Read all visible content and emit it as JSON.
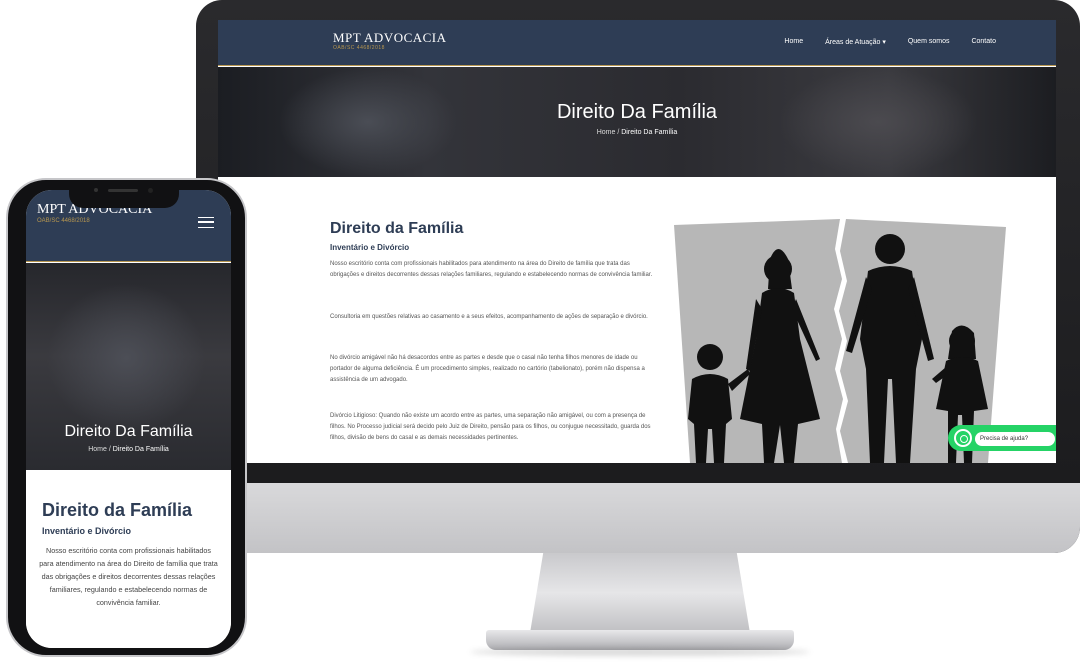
{
  "desktop": {
    "logo": "MPT ADVOCACIA",
    "logo_sub": "OAB/SC 4468/2018",
    "nav": [
      "Home",
      "Áreas de Atuação ▾",
      "Quem somos",
      "Contato"
    ],
    "hero_title": "Direito Da Família",
    "breadcrumb_home": "Home",
    "breadcrumb_sep": " / ",
    "breadcrumb_current": "Direito Da Família",
    "content_title": "Direito da Família",
    "content_subtitle": "Inventário e Divórcio",
    "paragraphs": [
      "Nosso escritório conta com profissionais habilitados para atendimento na área do Direito de família que trata das obrigações e direitos decorrentes dessas relações familiares, regulando e estabelecendo normas de convivência familiar.",
      "Consultoria em questões relativas ao casamento e a seus efeitos, acompanhamento de ações de separação e divórcio.",
      "No divórcio amigável não há desacordos entre as partes e desde que o casal não tenha filhos menores de idade ou portador de alguma deficiência. É um procedimento simples, realizado no cartório (tabelionato), porém não dispensa a assistência de um advogado.",
      "Divórcio Litigioso: Quando não existe um acordo entre as partes, uma separação não amigável, ou com a presença de filhos. No Processo judicial será decido pelo Juiz de Direito, pensão para os filhos, ou conjugue necessitado, guarda dos filhos, divisão de bens do casal e as demais necessidades pertinentes."
    ],
    "whatsapp_label": "Precisa de ajuda?"
  },
  "mobile": {
    "logo": "MPT ADVOCACIA",
    "logo_sub": "OAB/SC 4468/2018",
    "hero_title": "Direito Da Família",
    "breadcrumb_home": "Home",
    "breadcrumb_sep": " / ",
    "breadcrumb_current": "Direito Da Família",
    "content_title": "Direito da Família",
    "content_subtitle": "Inventário e Divórcio",
    "paragraph": "Nosso escritório conta com profissionais habilitados para atendimento na área do Direito de família que trata das obrigações e direitos decorrentes dessas relações familiares, regulando e estabelecendo normas de convivência familiar."
  },
  "colors": {
    "header_navy": "#2e3d55",
    "accent_gold": "#b8974f",
    "whatsapp_green": "#25d366"
  }
}
